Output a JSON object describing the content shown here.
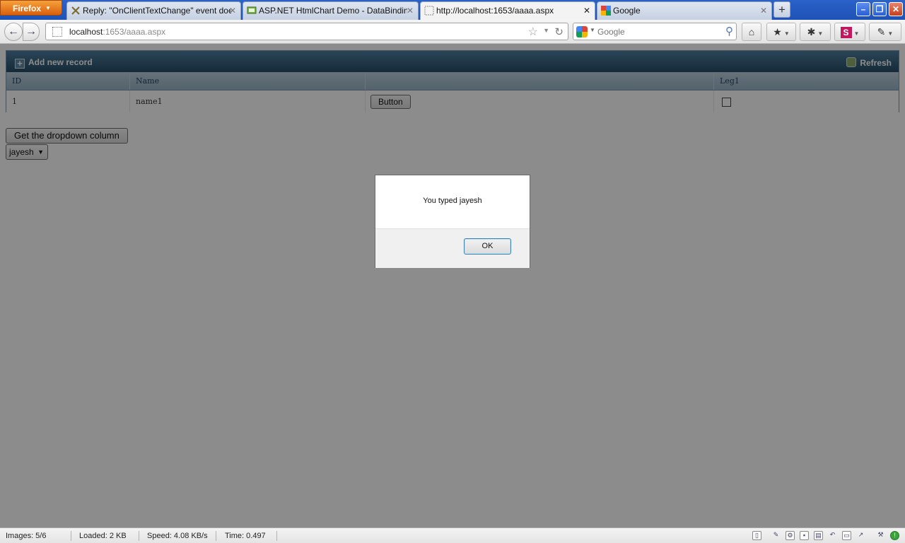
{
  "browser": {
    "menu_button": "Firefox",
    "tabs": [
      {
        "title": "Reply: \"OnClientTextChange\" event doe...",
        "active": false
      },
      {
        "title": "ASP.NET HtmlChart Demo - DataBinding - ...",
        "active": false
      },
      {
        "title": "http://localhost:1653/aaaa.aspx",
        "active": true
      },
      {
        "title": "Google",
        "active": false
      }
    ],
    "new_tab": "+",
    "url_host": "localhost",
    "url_rest": ":1653/aaaa.aspx",
    "search_placeholder": "Google"
  },
  "grid": {
    "add_new_record": "Add new record",
    "refresh": "Refresh",
    "columns": [
      "ID",
      "Name",
      "",
      "Leg1"
    ],
    "rows": [
      {
        "id": "1",
        "name": "name1",
        "button": "Button",
        "leg1": false
      }
    ]
  },
  "controls": {
    "get_column_button": "Get the dropdown column",
    "dropdown_value": "jayesh"
  },
  "dialog": {
    "message": "You typed jayesh",
    "ok": "OK"
  },
  "statusbar": {
    "images": "Images: 5/6",
    "loaded": "Loaded: 2 KB",
    "speed": "Speed: 4.08 KB/s",
    "time": "Time: 0.497"
  }
}
